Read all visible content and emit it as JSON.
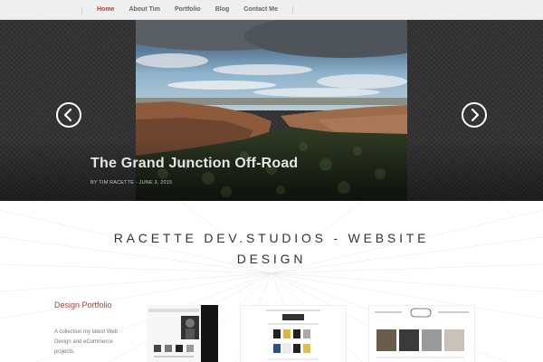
{
  "nav": {
    "items": [
      {
        "label": "Home",
        "active": true
      },
      {
        "label": "About Tim",
        "active": false
      },
      {
        "label": "Portfolio",
        "active": false
      },
      {
        "label": "Blog",
        "active": false
      },
      {
        "label": "Contact Me",
        "active": false
      }
    ]
  },
  "slider": {
    "title": "The Grand Junction Off-Road",
    "meta_prefix": "BY",
    "author": "TIM RACETTE",
    "separator": "-",
    "date": "JUNE 3, 2015",
    "prev_icon": "chevron-left-icon",
    "next_icon": "chevron-right-icon"
  },
  "main": {
    "site_title": "RACETTE DEV.STUDIOS - WEBSITE DESIGN",
    "portfolio_heading": "Design Portfolio",
    "portfolio_desc": "A collection my latest Web Design and eCommerce projects."
  },
  "colors": {
    "accent": "#c23b33",
    "nav_bg": "#efefef",
    "slider_bg": "#333333"
  }
}
